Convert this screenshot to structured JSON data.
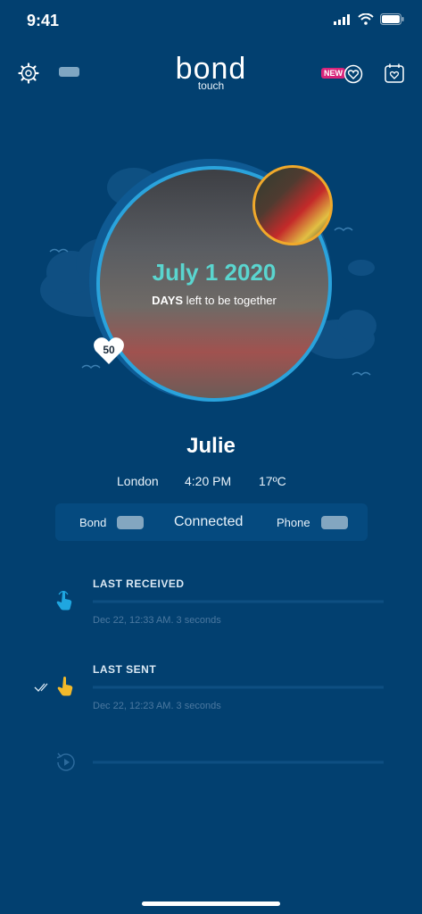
{
  "status_bar": {
    "time": "9:41"
  },
  "app": {
    "logo_main": "bond",
    "logo_sub": "touch",
    "new_badge": "NEW"
  },
  "hero": {
    "date": "July 1 2020",
    "caption_bold": "DAYS",
    "caption_rest": " left to be together",
    "heart_count": "50"
  },
  "partner": {
    "name": "Julie",
    "city": "London",
    "time": "4:20 PM",
    "temperature": "17ºC"
  },
  "connection": {
    "bond_label": "Bond",
    "status": "Connected",
    "phone_label": "Phone"
  },
  "last_received": {
    "title": "LAST RECEIVED",
    "meta": "Dec 22, 12:33 AM. 3 seconds",
    "color": "#1fa6e0"
  },
  "last_sent": {
    "title": "LAST SENT",
    "meta": "Dec 22, 12:23 AM. 3 seconds",
    "color": "#f2b92a"
  },
  "colors": {
    "background": "#024070",
    "accent_teal": "#5ad5cf",
    "ring": "#2aa3dc"
  },
  "icons": [
    "settings-gear-icon",
    "battery-icon",
    "new-heart-icon",
    "calendar-heart-icon",
    "touch-hand-icon",
    "double-check-icon",
    "replay-icon"
  ]
}
